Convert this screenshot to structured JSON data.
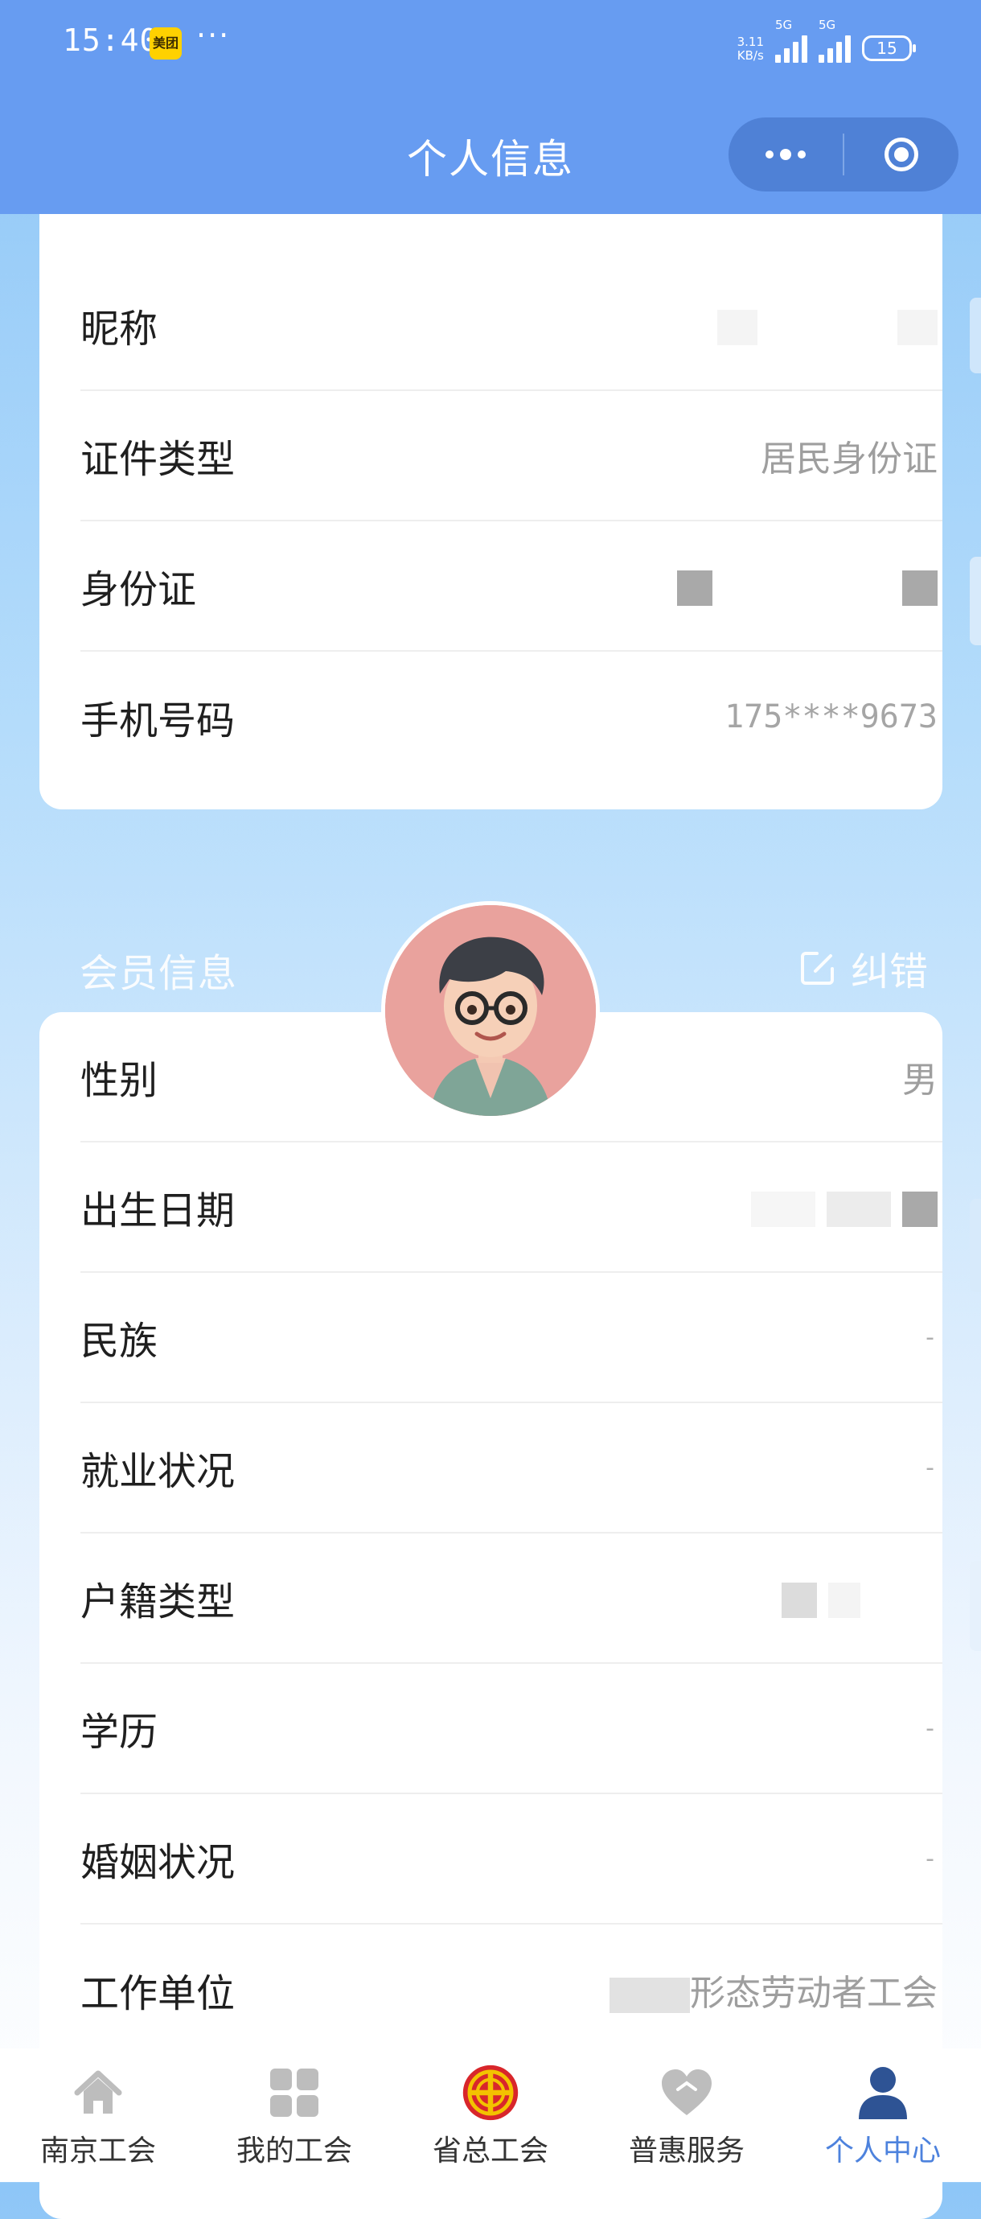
{
  "status_bar": {
    "time": "15:40",
    "app_badge": "美团",
    "more": "···",
    "speed_value": "3.11",
    "speed_unit": "KB/s",
    "signal1_label": "5G",
    "signal2_label": "5G",
    "battery": "15"
  },
  "nav": {
    "title": "个人信息"
  },
  "basic_info": {
    "rows": [
      {
        "label": "昵称",
        "value": ""
      },
      {
        "label": "证件类型",
        "value": "居民身份证"
      },
      {
        "label": "身份证",
        "value": ""
      },
      {
        "label": "手机号码",
        "value": "175****9673"
      }
    ]
  },
  "member_info": {
    "section_title": "会员信息",
    "correct_label": "纠错",
    "rows": [
      {
        "label": "性别",
        "value": "男"
      },
      {
        "label": "出生日期",
        "value": ""
      },
      {
        "label": "民族",
        "value": "-"
      },
      {
        "label": "就业状况",
        "value": "-"
      },
      {
        "label": "户籍类型",
        "value": ""
      },
      {
        "label": "学历",
        "value": "-"
      },
      {
        "label": "婚姻状况",
        "value": "-"
      },
      {
        "label": "工作单位",
        "value": "形态劳动者工会"
      }
    ]
  },
  "tabbar": {
    "tabs": [
      {
        "label": "南京工会",
        "icon": "home-icon"
      },
      {
        "label": "我的工会",
        "icon": "grid-icon"
      },
      {
        "label": "省总工会",
        "icon": "union-emblem-icon"
      },
      {
        "label": "普惠服务",
        "icon": "heart-icon"
      },
      {
        "label": "个人中心",
        "icon": "person-icon"
      }
    ],
    "active_color": "#4d82dd"
  },
  "colors": {
    "nav_bg": "#679cf1",
    "capsule_bg": "#4f81d6",
    "union_red": "#d8262b"
  }
}
